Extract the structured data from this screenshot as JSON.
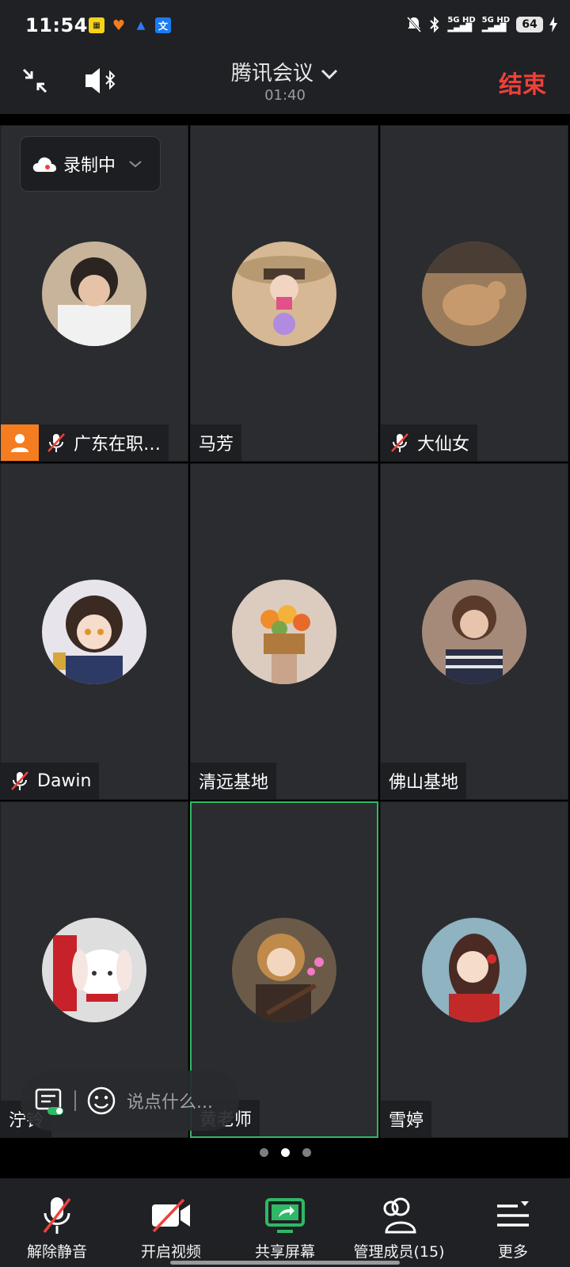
{
  "status_bar": {
    "time": "11:54",
    "network_1": "5G HD",
    "network_2": "5G HD",
    "battery": "64",
    "notification_icons": [
      "weibo-icon",
      "taobao-icon",
      "vpn-icon",
      "translate-icon"
    ],
    "system_icons": [
      "mute-icon",
      "bluetooth-icon",
      "signal-icon",
      "battery-icon",
      "charging-icon"
    ]
  },
  "header": {
    "title": "腾讯会议",
    "elapsed": "01:40",
    "end_label": "结束",
    "end_color": "#f0403a"
  },
  "recording": {
    "label": "录制中"
  },
  "participants": [
    {
      "name": "广东在职…",
      "host": true,
      "muted": true,
      "avatar_bg": "#c8b49a"
    },
    {
      "name": "马芳",
      "host": false,
      "muted": false,
      "avatar_bg": "#d6b894"
    },
    {
      "name": "大仙女",
      "host": false,
      "muted": true,
      "avatar_bg": "#9a7c5c"
    },
    {
      "name": "Dawin",
      "host": false,
      "muted": true,
      "avatar_bg": "#e8e4ec"
    },
    {
      "name": "清远基地",
      "host": false,
      "muted": false,
      "avatar_bg": "#dcccc0"
    },
    {
      "name": "佛山基地",
      "host": false,
      "muted": false,
      "avatar_bg": "#a58a7a"
    },
    {
      "name": "泞铃",
      "host": false,
      "muted": false,
      "avatar_bg": "#dedede"
    },
    {
      "name": "黄老师",
      "host": false,
      "muted": false,
      "speaking": true,
      "avatar_bg": "#6b5a48"
    },
    {
      "name": "雪婷",
      "host": false,
      "muted": false,
      "avatar_bg": "#8fb3c0"
    }
  ],
  "chat": {
    "placeholder": "说点什么..."
  },
  "pager": {
    "pages": 3,
    "current": 2
  },
  "toolbar": {
    "unmute": "解除静音",
    "video": "开启视频",
    "share": "共享屏幕",
    "members": "管理成员(15)",
    "more": "更多",
    "share_color": "#2fb865"
  }
}
